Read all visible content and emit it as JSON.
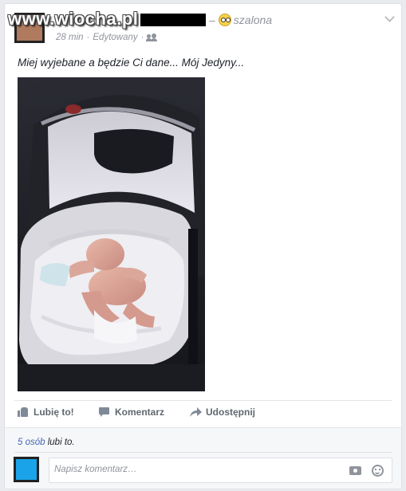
{
  "watermark": "www.wiocha.pl",
  "post": {
    "separator": "–",
    "feeling": "szalona",
    "time": "28 min",
    "meta_separator": "·",
    "edited": "Edytowany",
    "audience_icon": "friends-icon",
    "text": "Miej wyjebane a będzie Ci dane... Mój Jedyny..."
  },
  "photo": {
    "subject": "baby-in-pram-photo"
  },
  "actions": {
    "like": "Lubię to!",
    "comment": "Komentarz",
    "share": "Udostępnij"
  },
  "likes": {
    "count": "5 osób",
    "suffix": " lubi to."
  },
  "comment_input": {
    "placeholder": "Napisz komentarz…"
  },
  "colors": {
    "link": "#4267b2",
    "meta": "#90949c",
    "text": "#1d2129",
    "background": "#e9ebee"
  }
}
